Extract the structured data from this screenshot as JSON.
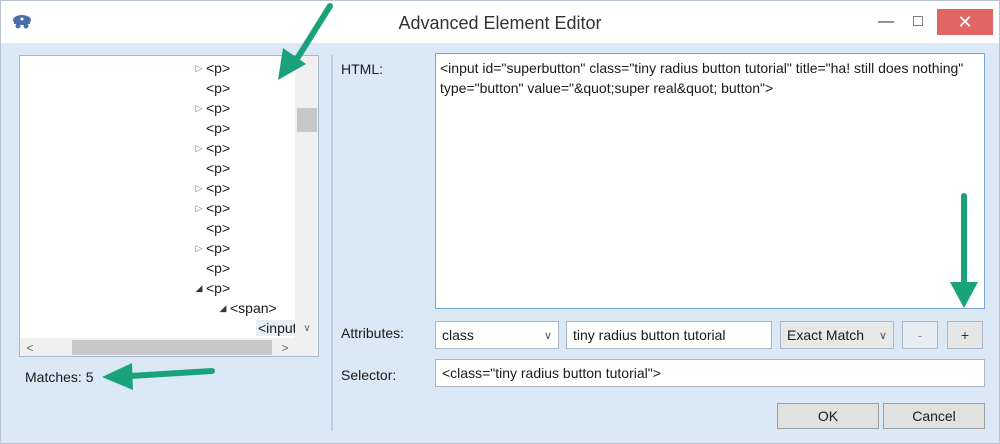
{
  "window": {
    "title": "Advanced Element Editor",
    "controls": {
      "minimize": "—",
      "maximize": "□",
      "close": "✕"
    }
  },
  "tree": {
    "rows": [
      {
        "label": "<p>",
        "toggle": "▷"
      },
      {
        "label": "<p>",
        "toggle": ""
      },
      {
        "label": "<p>",
        "toggle": "▷"
      },
      {
        "label": "<p>",
        "toggle": ""
      },
      {
        "label": "<p>",
        "toggle": "▷"
      },
      {
        "label": "<p>",
        "toggle": ""
      },
      {
        "label": "<p>",
        "toggle": "▷"
      },
      {
        "label": "<p>",
        "toggle": "▷"
      },
      {
        "label": "<p>",
        "toggle": ""
      },
      {
        "label": "<p>",
        "toggle": "▷"
      },
      {
        "label": "<p>",
        "toggle": ""
      },
      {
        "label": "<p>",
        "toggle": "◢"
      },
      {
        "label": "<span>",
        "toggle": "◢"
      },
      {
        "label": "<input>",
        "toggle": ""
      }
    ],
    "scroll": {
      "down": "∨",
      "left": "<",
      "right": ">"
    }
  },
  "matches": "Matches: 5",
  "html": {
    "label": "HTML:",
    "value": "<input id=\"superbutton\" class=\"tiny radius button tutorial\" title=\"ha! still does nothing\" type=\"button\" value=\"&quot;super real&quot; button\">"
  },
  "attributes": {
    "label": "Attributes:",
    "attribute": "class",
    "value": "tiny radius button tutorial",
    "match_mode": "Exact Match",
    "remove_label": "-",
    "add_label": "+"
  },
  "selector": {
    "label": "Selector:",
    "value": "<class=\"tiny radius button tutorial\">"
  },
  "buttons": {
    "ok": "OK",
    "cancel": "Cancel"
  }
}
